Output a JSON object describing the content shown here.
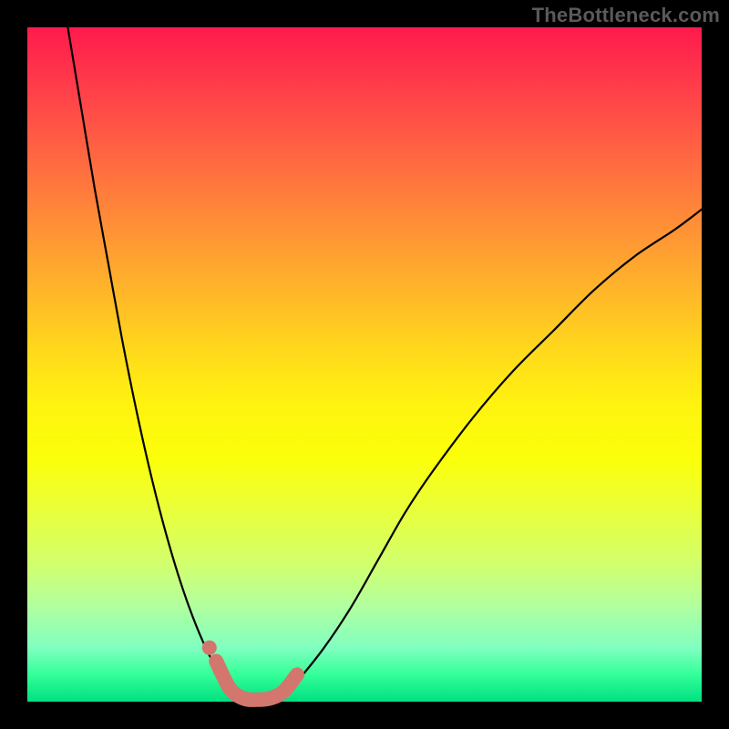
{
  "watermark": "TheBottleneck.com",
  "chart_data": {
    "type": "line",
    "title": "",
    "xlabel": "",
    "ylabel": "",
    "xlim": [
      0,
      100
    ],
    "ylim": [
      0,
      100
    ],
    "grid": false,
    "legend": false,
    "series": [
      {
        "name": "left-branch",
        "x": [
          6,
          8,
          10,
          12,
          14,
          16,
          18,
          20,
          22,
          24,
          26,
          28,
          30,
          31
        ],
        "values": [
          100,
          88,
          76,
          65,
          54,
          44,
          35,
          27,
          20,
          14,
          9,
          5,
          2,
          1
        ]
      },
      {
        "name": "right-branch",
        "x": [
          38,
          40,
          44,
          48,
          52,
          56,
          60,
          66,
          72,
          78,
          84,
          90,
          96,
          100
        ],
        "values": [
          1,
          3,
          8,
          14,
          21,
          28,
          34,
          42,
          49,
          55,
          61,
          66,
          70,
          73
        ]
      },
      {
        "name": "optimal-band",
        "x": [
          28,
          30,
          32,
          34,
          36,
          38,
          40
        ],
        "values": [
          6,
          2,
          0.5,
          0.3,
          0.5,
          1.5,
          4
        ]
      }
    ],
    "annotations": [
      {
        "name": "left-marker-dot",
        "x": 27,
        "y": 8
      }
    ],
    "colors": {
      "curve": "#000000",
      "marker": "#d3766d",
      "gradient_top": "#ff1a4d",
      "gradient_bottom": "#00e080"
    }
  }
}
